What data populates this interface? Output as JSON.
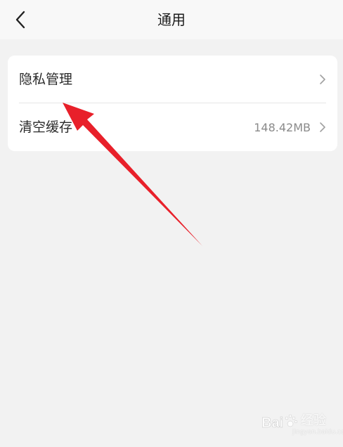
{
  "header": {
    "title": "通用",
    "back_icon": "chevron-left-icon"
  },
  "settings": {
    "items": [
      {
        "label": "隐私管理",
        "value": "",
        "icon": "chevron-right-icon"
      },
      {
        "label": "清空缓存",
        "value": "148.42MB",
        "icon": "chevron-right-icon"
      }
    ]
  },
  "annotation": {
    "arrow_color": "#e8202a"
  },
  "watermark": {
    "logo_text": "Bai",
    "suffix_text": "经验",
    "url": "jingyan.baidu.com"
  },
  "colors": {
    "background": "#f2f2f2",
    "card": "#ffffff",
    "secondary_text": "#8a8a8a"
  }
}
